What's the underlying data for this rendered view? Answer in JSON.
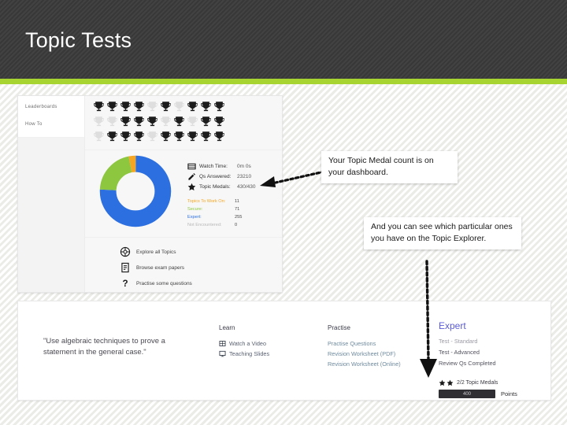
{
  "header": {
    "title": "Topic Tests",
    "accent_color": "#a8d432",
    "background_color": "#3b3b3b"
  },
  "dashboard": {
    "sidebar": [
      {
        "label": "Leaderboards"
      },
      {
        "label": "How To"
      }
    ],
    "trophies": {
      "columns": 10,
      "rows": 3,
      "earned_color": "#1c1c1c",
      "unearned_color": "#dedede",
      "states": [
        [
          1,
          1,
          1,
          1,
          0,
          1,
          0,
          1,
          1,
          1
        ],
        [
          0,
          0,
          1,
          1,
          1,
          0,
          1,
          0,
          1,
          1
        ],
        [
          0,
          1,
          1,
          1,
          0,
          1,
          1,
          1,
          1,
          1
        ]
      ]
    },
    "stats": [
      {
        "icon": "video-icon",
        "label": "Watch Time:",
        "value": "0m 0s"
      },
      {
        "icon": "pencil-icon",
        "label": "Qs Answered:",
        "value": "23210"
      },
      {
        "icon": "star-icon",
        "label": "Topic Medals:",
        "value": "430/430"
      }
    ],
    "legend": [
      {
        "label": "Topics To Work On:",
        "value": "11",
        "color": "#f5a623"
      },
      {
        "label": "Secure:",
        "value": "71",
        "color": "#8dc63f"
      },
      {
        "label": "Expert:",
        "value": "255",
        "color": "#2c6fe0"
      },
      {
        "label": "Not Encountered:",
        "value": "0",
        "color": "#b8b8b8"
      }
    ],
    "donut": {
      "segments": [
        {
          "name": "Expert",
          "value": 255,
          "color": "#2c6fe0"
        },
        {
          "name": "Secure",
          "value": 71,
          "color": "#8dc63f"
        },
        {
          "name": "Topics To Work On",
          "value": 11,
          "color": "#f5a623"
        }
      ]
    },
    "links": [
      {
        "icon": "compass-icon",
        "label": "Explore all Topics"
      },
      {
        "icon": "document-icon",
        "label": "Browse exam papers"
      },
      {
        "icon": "question-icon",
        "label": "Practise some questions"
      }
    ]
  },
  "explorer": {
    "quote": "\"Use algebraic techniques to prove a statement in the general case.\"",
    "learn": {
      "heading": "Learn",
      "items": [
        {
          "icon": "film-icon",
          "label": "Watch a Video"
        },
        {
          "icon": "slides-icon",
          "label": "Teaching Slides"
        }
      ]
    },
    "practise": {
      "heading": "Practise",
      "items": [
        {
          "label": "Practise Questions"
        },
        {
          "label": "Revision Worksheet (PDF)"
        },
        {
          "label": "Revision Worksheet (Online)"
        }
      ]
    },
    "expert": {
      "heading": "Expert",
      "heading_color": "#5b5bd6",
      "rows": [
        {
          "label": "Test - Standard",
          "dim": true
        },
        {
          "label": "Test - Advanced",
          "dim": false
        },
        {
          "label": "Review Qs Completed",
          "dim": false
        }
      ],
      "medals_text": "2/2 Topic Medals",
      "points_value": "400",
      "points_label": "Points"
    }
  },
  "callouts": [
    {
      "text": "Your Topic Medal count is on your dashboard."
    },
    {
      "text": "And you can see which particular ones you have on the Topic Explorer."
    }
  ]
}
